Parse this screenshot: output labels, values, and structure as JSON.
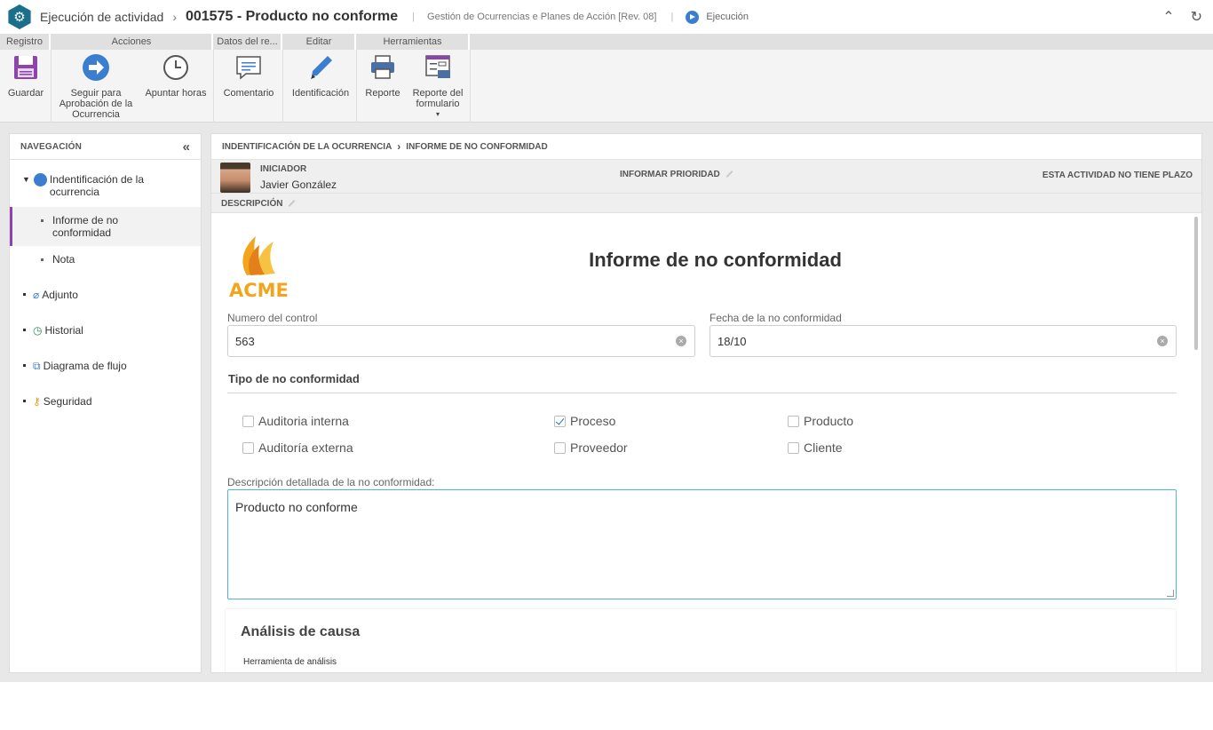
{
  "titlebar": {
    "root": "Ejecución de actividad",
    "title": "001575 - Producto no conforme",
    "process": "Gestión de Ocurrencias e Planes de Acción [Rev. 08]",
    "status": "Ejecución"
  },
  "ribbon": {
    "groups": [
      "Registro",
      "Acciones",
      "Datos del re...",
      "Editar",
      "Herramientas"
    ],
    "buttons": {
      "save": "Guardar",
      "approve_l1": "Seguir para",
      "approve_l2": "Aprobación de la",
      "approve_l3": "Ocurrencia",
      "hours": "Apuntar horas",
      "comment": "Comentario",
      "identification": "Identificación",
      "report": "Reporte",
      "form_report_l1": "Reporte del",
      "form_report_l2": "formulario"
    }
  },
  "nav": {
    "header": "NAVEGACIÓN",
    "items": {
      "identification_l1": "Indentificación de la",
      "identification_l2": "ocurrencia",
      "report_l1": "Informe de no",
      "report_l2": "conformidad",
      "note": "Nota",
      "attachment": "Adjunto",
      "history": "Historial",
      "flowchart": "Diagrama de flujo",
      "security": "Seguridad"
    }
  },
  "main": {
    "breadcrumb_parent": "INDENTIFICACIÓN DE LA OCURRENCIA",
    "breadcrumb_current": "INFORME DE NO CONFORMIDAD",
    "initiator_label": "INICIADOR",
    "initiator_name": "Javier González",
    "priority": "INFORMAR PRIORIDAD",
    "deadline": "ESTA ACTIVIDAD NO TIENE PLAZO",
    "description_label": "DESCRIPCIÓN"
  },
  "form": {
    "logo_text": "ACME",
    "title": "Informe de no conformidad",
    "control_number_label": "Numero del control",
    "control_number_value": "563",
    "date_label": "Fecha de la no conformidad",
    "date_value": "18/10",
    "type_title": "Tipo de no conformidad",
    "checkboxes": {
      "internal_audit": "Auditoria interna",
      "process": "Proceso",
      "product": "Producto",
      "external_audit": "Auditoría externa",
      "supplier": "Proveedor",
      "client": "Cliente"
    },
    "detail_label": "Descripción detallada de la no conformidad:",
    "detail_value": "Producto no conforme",
    "cause_title": "Análisis de causa",
    "analysis_tool_label": "Herramienta de análisis"
  },
  "colors": {
    "accent": "#3b7ed0",
    "nav_active": "#8e44ad",
    "textarea_focus": "#4db3e6",
    "logo_orange": "#f2a41c"
  }
}
